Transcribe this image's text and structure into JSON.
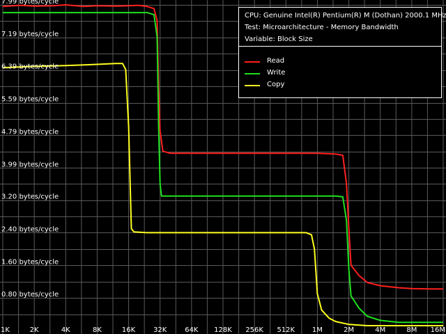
{
  "colors": {
    "background": "#000000",
    "grid": "#5a5a5a",
    "text": "#ffffff",
    "read": "#ff2020",
    "write": "#20e020",
    "copy": "#ffff20"
  },
  "legend": {
    "info": [
      "CPU: Genuine Intel(R) Pentium(R) M (Dothan) 2000.1 MHz",
      "Test: Microarchitecture - Memory Bandwidth",
      "Variable: Block Size"
    ],
    "entries": [
      "Read",
      "Write",
      "Copy"
    ]
  },
  "chart_data": {
    "type": "line",
    "x_scale": "log2",
    "x_tick_labels": [
      "1K",
      "2K",
      "4K",
      "8K",
      "16K",
      "32K",
      "64K",
      "128K",
      "256K",
      "512K",
      "1M",
      "2M",
      "4M",
      "8M",
      "16M"
    ],
    "y_tick_labels": [
      "0.80 bytes/cycle",
      "1.60 bytes/cycle",
      "2.40 bytes/cycle",
      "3.20 bytes/cycle",
      "3.99 bytes/cycle",
      "4.79 bytes/cycle",
      "5.59 bytes/cycle",
      "6.39 bytes/cycle",
      "7.19 bytes/cycle",
      "7.99 bytes/cycle"
    ],
    "y_tick_values": [
      0.8,
      1.6,
      2.4,
      3.2,
      3.99,
      4.79,
      5.59,
      6.39,
      7.19,
      7.99
    ],
    "ylim": [
      0,
      7.99
    ],
    "grid": true,
    "legend_position": "top-right",
    "series": [
      {
        "name": "Read",
        "color": "#ff2020",
        "points": [
          [
            "1K",
            7.95
          ],
          [
            "1.5K",
            7.98
          ],
          [
            "2K",
            7.96
          ],
          [
            "3K",
            7.97
          ],
          [
            "4K",
            7.99
          ],
          [
            "6K",
            7.95
          ],
          [
            "8K",
            7.97
          ],
          [
            "12K",
            7.96
          ],
          [
            "16K",
            7.97
          ],
          [
            "20K",
            7.98
          ],
          [
            "24K",
            7.95
          ],
          [
            "28K",
            7.9
          ],
          [
            "30K",
            7.6
          ],
          [
            "31K",
            6.0
          ],
          [
            "32K",
            4.9
          ],
          [
            "34K",
            4.4
          ],
          [
            "40K",
            4.35
          ],
          [
            "64K",
            4.35
          ],
          [
            "128K",
            4.35
          ],
          [
            "256K",
            4.35
          ],
          [
            "512K",
            4.35
          ],
          [
            "1M",
            4.35
          ],
          [
            "1.5M",
            4.33
          ],
          [
            "1.75M",
            4.3
          ],
          [
            "1.9M",
            3.6
          ],
          [
            "2M",
            2.5
          ],
          [
            "2.1M",
            1.6
          ],
          [
            "2.5M",
            1.35
          ],
          [
            "3M",
            1.18
          ],
          [
            "4M",
            1.1
          ],
          [
            "6M",
            1.05
          ],
          [
            "8M",
            1.03
          ],
          [
            "12M",
            1.02
          ],
          [
            "16M",
            1.02
          ]
        ]
      },
      {
        "name": "Write",
        "color": "#20e020",
        "points": [
          [
            "1K",
            7.8
          ],
          [
            "2K",
            7.8
          ],
          [
            "4K",
            7.8
          ],
          [
            "8K",
            7.8
          ],
          [
            "16K",
            7.8
          ],
          [
            "24K",
            7.8
          ],
          [
            "28K",
            7.75
          ],
          [
            "30K",
            7.2
          ],
          [
            "31K",
            5.0
          ],
          [
            "32K",
            3.6
          ],
          [
            "33K",
            3.3
          ],
          [
            "40K",
            3.3
          ],
          [
            "64K",
            3.3
          ],
          [
            "128K",
            3.3
          ],
          [
            "256K",
            3.3
          ],
          [
            "512K",
            3.3
          ],
          [
            "1M",
            3.3
          ],
          [
            "1.5M",
            3.3
          ],
          [
            "1.75M",
            3.28
          ],
          [
            "1.9M",
            2.7
          ],
          [
            "2M",
            1.5
          ],
          [
            "2.1M",
            0.85
          ],
          [
            "2.5M",
            0.55
          ],
          [
            "3M",
            0.35
          ],
          [
            "4M",
            0.25
          ],
          [
            "6M",
            0.2
          ],
          [
            "8M",
            0.2
          ],
          [
            "12M",
            0.2
          ],
          [
            "16M",
            0.2
          ]
        ]
      },
      {
        "name": "Copy",
        "color": "#ffff20",
        "points": [
          [
            "1K",
            6.45
          ],
          [
            "2K",
            6.48
          ],
          [
            "4K",
            6.5
          ],
          [
            "8K",
            6.53
          ],
          [
            "12K",
            6.55
          ],
          [
            "14K",
            6.55
          ],
          [
            "15K",
            6.4
          ],
          [
            "16K",
            5.0
          ],
          [
            "17K",
            2.5
          ],
          [
            "18K",
            2.42
          ],
          [
            "24K",
            2.4
          ],
          [
            "32K",
            2.4
          ],
          [
            "64K",
            2.4
          ],
          [
            "128K",
            2.4
          ],
          [
            "256K",
            2.4
          ],
          [
            "512K",
            2.4
          ],
          [
            "800K",
            2.4
          ],
          [
            "900K",
            2.35
          ],
          [
            "960K",
            2.0
          ],
          [
            "1M",
            0.9
          ],
          [
            "1.1M",
            0.5
          ],
          [
            "1.3M",
            0.3
          ],
          [
            "1.5M",
            0.22
          ],
          [
            "2M",
            0.15
          ],
          [
            "3M",
            0.12
          ],
          [
            "4M",
            0.12
          ],
          [
            "8M",
            0.12
          ],
          [
            "16M",
            0.12
          ]
        ]
      }
    ]
  }
}
